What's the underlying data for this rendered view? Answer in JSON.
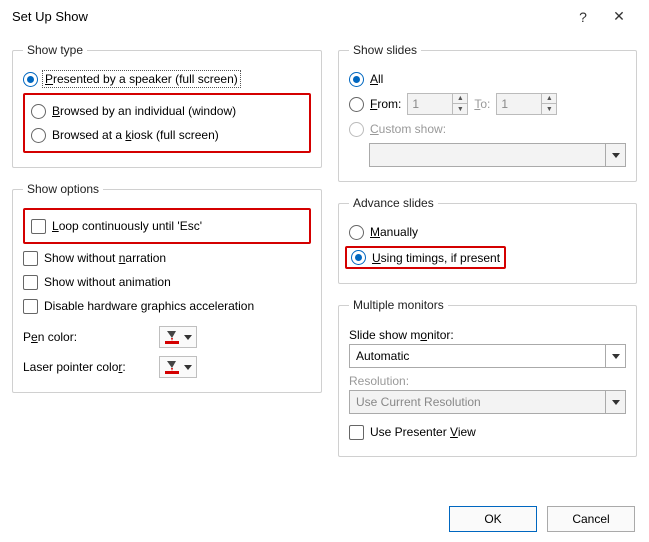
{
  "window": {
    "title": "Set Up Show",
    "help": "?",
    "close": "✕"
  },
  "showType": {
    "legend": "Show type",
    "opt1": "Presented by a speaker (full screen)",
    "opt2": "Browsed by an individual (window)",
    "opt3": "Browsed at a kiosk (full screen)"
  },
  "showOptions": {
    "legend": "Show options",
    "loop": "Loop continuously until 'Esc'",
    "noNarration": "Show without narration",
    "noAnimation": "Show without animation",
    "noHWAccel": "Disable hardware graphics acceleration",
    "penColorLabel": "Pen color:",
    "laserColorLabel": "Laser pointer color:"
  },
  "showSlides": {
    "legend": "Show slides",
    "all": "All",
    "from": "From:",
    "fromVal": "1",
    "to": "To:",
    "toVal": "1",
    "custom": "Custom show:",
    "customVal": ""
  },
  "advance": {
    "legend": "Advance slides",
    "manually": "Manually",
    "timings": "Using timings, if present"
  },
  "monitors": {
    "legend": "Multiple monitors",
    "monitorLabel": "Slide show monitor:",
    "monitorVal": "Automatic",
    "resLabel": "Resolution:",
    "resVal": "Use Current Resolution",
    "presenterView": "Use Presenter View"
  },
  "buttons": {
    "ok": "OK",
    "cancel": "Cancel"
  }
}
